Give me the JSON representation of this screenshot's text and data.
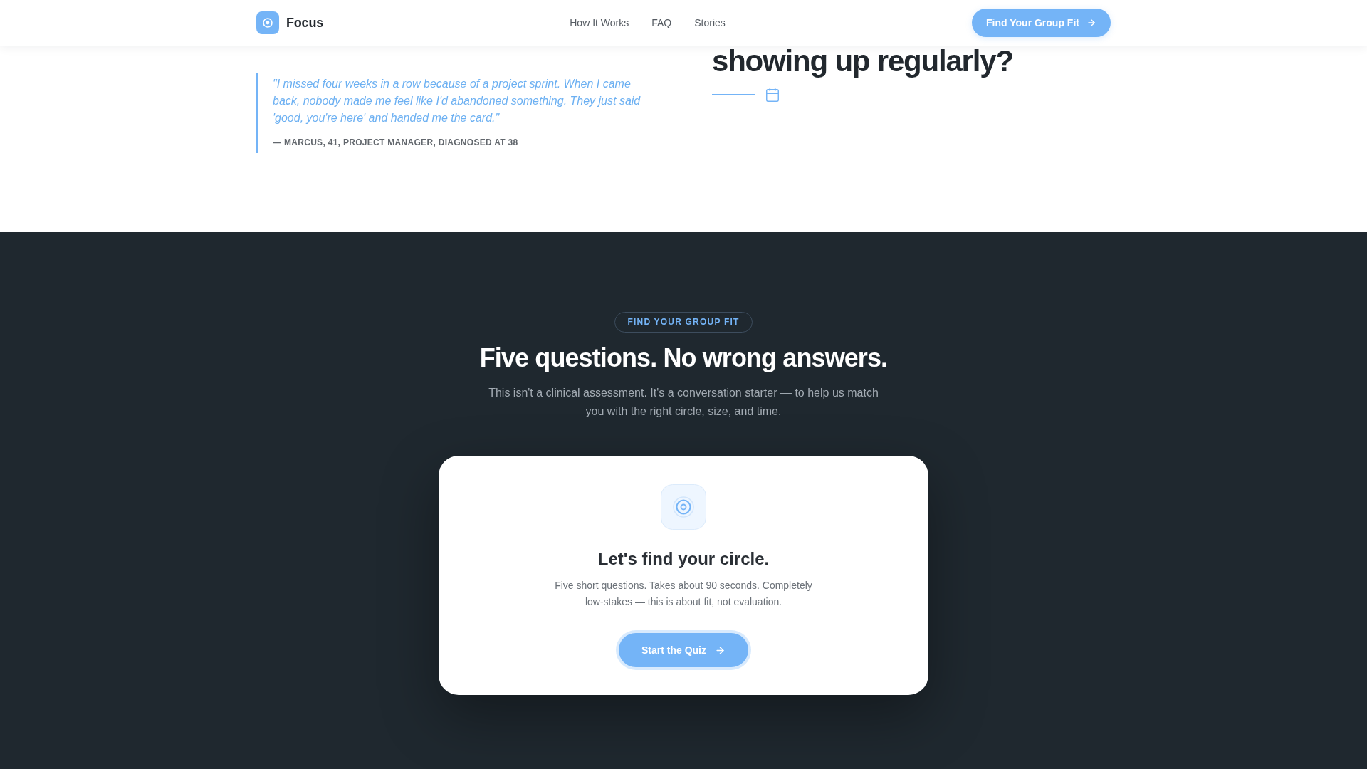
{
  "header": {
    "brand": "Focus",
    "nav": [
      "How It Works",
      "FAQ",
      "Stories"
    ],
    "cta": "Find Your Group Fit"
  },
  "story": {
    "quote": "\"I missed four weeks in a row because of a project sprint. When I came back, nobody made me feel like I'd abandoned something. They just said 'good, you're here' and handed me the card.\"",
    "attribution": "— MARCUS, 41, PROJECT MANAGER, DIAGNOSED AT 38",
    "heading": "showing up regularly?"
  },
  "quiz": {
    "badge": "FIND YOUR GROUP FIT",
    "title": "Five questions. No wrong answers.",
    "subtitle": "This isn't a clinical assessment. It's a conversation starter — to help us match you with the right circle, size, and time.",
    "card": {
      "title": "Let's find your circle.",
      "text": "Five short questions. Takes about 90 seconds. Completely low-stakes — this is about fit, not evaluation.",
      "button": "Start the Quiz"
    }
  }
}
